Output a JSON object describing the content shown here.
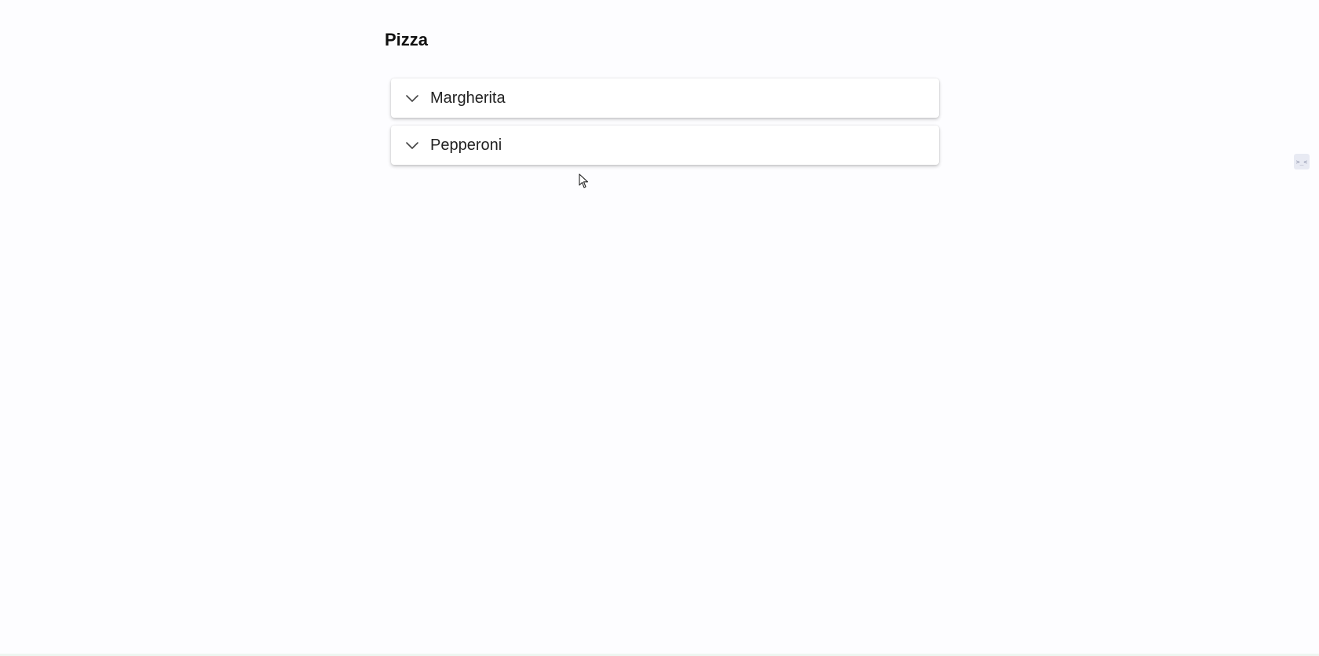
{
  "page": {
    "title": "Pizza"
  },
  "accordion": {
    "items": [
      {
        "label": "Margherita",
        "icon": "chevron-down-icon",
        "expanded": false
      },
      {
        "label": "Pepperoni",
        "icon": "chevron-down-icon",
        "expanded": false
      }
    ]
  },
  "side_widget": {
    "icon": "terminal-icon",
    "glyph": ">_<"
  },
  "colors": {
    "background": "#fdfdff",
    "card": "#ffffff",
    "text": "#222222",
    "title": "#111111"
  }
}
